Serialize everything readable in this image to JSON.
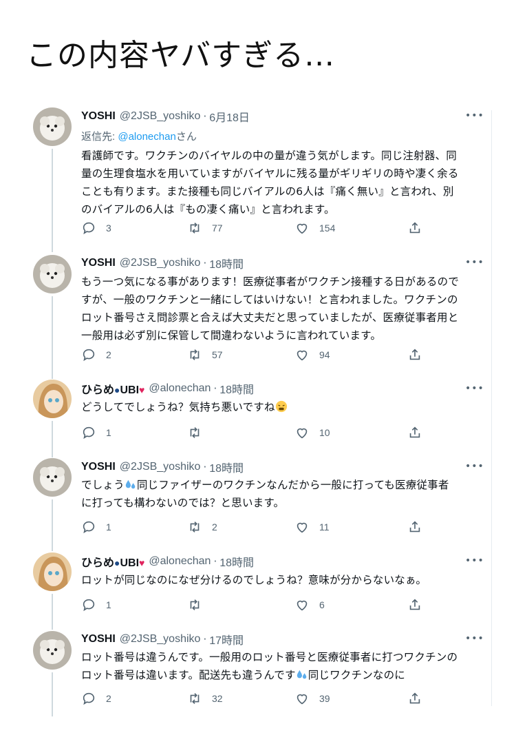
{
  "headline": "この内容ヤバすぎる…",
  "tweets": [
    {
      "name": "YOSHI",
      "handle": "@2JSB_yoshiko",
      "sep": "·",
      "time": "6月18日",
      "more": "•••",
      "reply_prefix": "返信先: ",
      "reply_mention": "@alonechan",
      "reply_suffix": "さん",
      "lines": [
        "看護師です。ワクチンのバイヤルの中の量が違う気がします。同じ注射器、同",
        "量の生理食塩水を用いていますがバイヤルに残る量がギリギリの時や凄く余る",
        "ことも有ります。また接種も同じバイアルの6人は『痛く無い』と言われ、別",
        "のバイアルの6人は『もの凄く痛い』と言われます。"
      ],
      "replies": "3",
      "retweets": "77",
      "likes": "154"
    },
    {
      "name": "YOSHI",
      "handle": "@2JSB_yoshiko",
      "sep": "·",
      "time": "18時間",
      "more": "•••",
      "lines": [
        "もう一つ気になる事があります！医療従事者がワクチン接種する日があるので",
        "すが、一般のワクチンと一緒にしてはいけない！と言われました。ワクチンの",
        "ロット番号さえ問診票と合えば大丈夫だと思っていましたが、医療従事者用と",
        "一般用は必ず別に保管して間違わないように言われています。"
      ],
      "replies": "2",
      "retweets": "57",
      "likes": "94"
    },
    {
      "name": "ひらめ",
      "name_suffix": "UBI",
      "handle": "@alonechan",
      "sep": "·",
      "time": "18時間",
      "more": "•••",
      "lines": [
        "どうしてでしょうね？気持ち悪いですね"
      ],
      "replies": "1",
      "retweets": "",
      "likes": "10"
    },
    {
      "name": "YOSHI",
      "handle": "@2JSB_yoshiko",
      "sep": "·",
      "time": "18時間",
      "more": "•••",
      "lines_a": "でしょう",
      "lines_b": "同じファイザーのワクチンなんだから一般に打っても医療従事者",
      "lines": [
        "に打っても構わないのでは？と思います。"
      ],
      "replies": "1",
      "retweets": "2",
      "likes": "11"
    },
    {
      "name": "ひらめ",
      "name_suffix": "UBI",
      "handle": "@alonechan",
      "sep": "·",
      "time": "18時間",
      "more": "•••",
      "lines": [
        "ロットが同じなのになぜ分けるのでしょうね？意味が分からないなぁ。"
      ],
      "replies": "1",
      "retweets": "",
      "likes": "6"
    },
    {
      "name": "YOSHI",
      "handle": "@2JSB_yoshiko",
      "sep": "·",
      "time": "17時間",
      "more": "•••",
      "lines": [
        "ロット番号は違うんです。一般用のロット番号と医療従事者に打つワクチンの"
      ],
      "last_a": "ロット番号は違います。配送先も違うんです",
      "last_b": "同じワクチンなのに",
      "replies": "2",
      "retweets": "32",
      "likes": "39"
    }
  ],
  "colors": {
    "text": "#0f1419",
    "muted": "#536471",
    "link": "#1d9bf0",
    "thread_line": "#cfd9de"
  }
}
